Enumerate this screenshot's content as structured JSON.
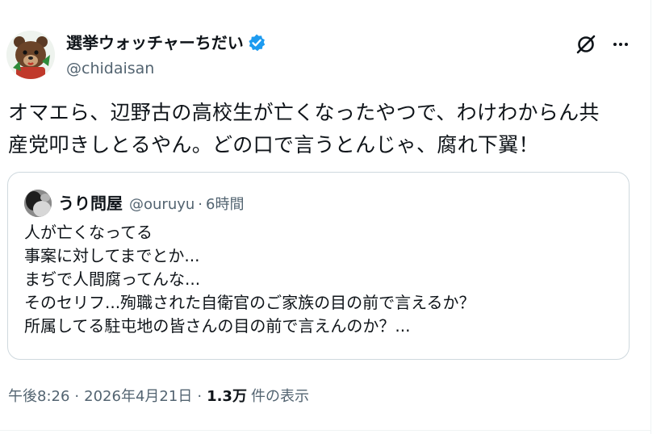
{
  "author": {
    "display_name": "選挙ウォッチャーちだい",
    "handle": "@chidaisan",
    "verified": true
  },
  "tweet": {
    "text_line1": "オマエら、辺野古の高校生が亡くなったやつで、わけわからん共",
    "text_line2": "産党叩きしとるやん。どの口で言うとんじゃ、腐れ下翼！"
  },
  "quoted_tweet": {
    "display_name": "うり問屋",
    "handle": "@ouruyu",
    "separator": "·",
    "time": "6時間",
    "lines": [
      "人が亡くなってる",
      "事案に対してまでとか...",
      "まぢで人間腐ってんな...",
      "そのセリフ...殉職された自衛官のご家族の目の前で言えるか？",
      "所属してる駐屯地の皆さんの目の前で言えんのか？..."
    ]
  },
  "meta": {
    "time": "午後8:26",
    "separator": "·",
    "date": "2026年4月21日",
    "views_count": "1.3万",
    "views_label": "件の表示"
  },
  "icons": {
    "grok": "grok-icon",
    "more": "more-horizontal-icon",
    "verified": "verified-badge-icon"
  },
  "colors": {
    "verified_blue": "#1d9bf0",
    "secondary_text": "#536471",
    "border": "#cfd9de"
  }
}
